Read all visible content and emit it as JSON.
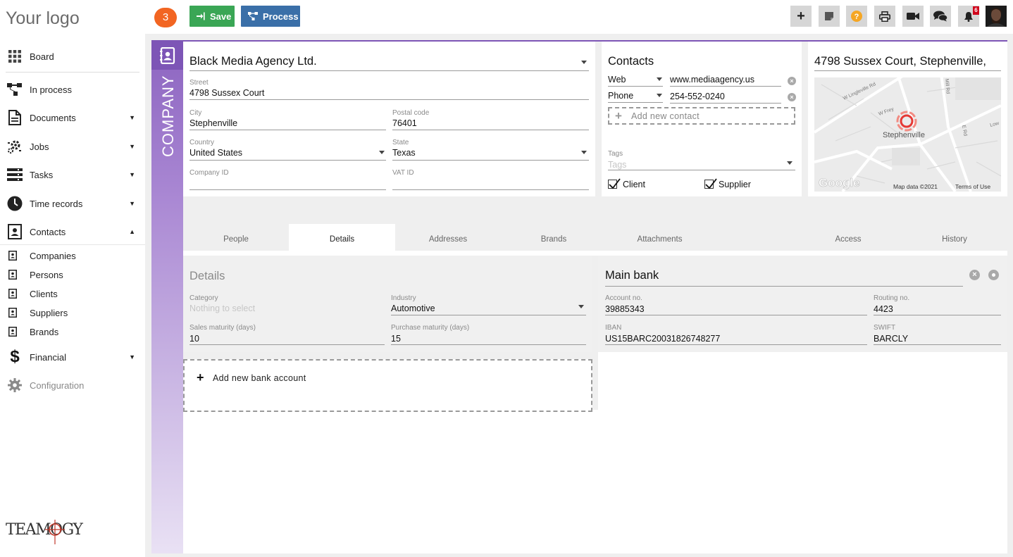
{
  "app": {
    "logo": "Your logo",
    "brand": "TEAMOGY",
    "step_badge": "3"
  },
  "toolbar": {
    "save_label": "Save",
    "process_label": "Process",
    "notification_count": "6"
  },
  "sidebar": {
    "items": [
      {
        "label": "Board",
        "icon": "grid-icon"
      },
      {
        "label": "In process",
        "icon": "process-icon"
      },
      {
        "label": "Documents",
        "icon": "document-icon"
      },
      {
        "label": "Jobs",
        "icon": "jobs-icon"
      },
      {
        "label": "Tasks",
        "icon": "tasks-icon"
      },
      {
        "label": "Time records",
        "icon": "clock-icon"
      },
      {
        "label": "Contacts",
        "icon": "contacts-icon"
      },
      {
        "label": "Financial",
        "icon": "dollar-icon"
      },
      {
        "label": "Configuration",
        "icon": "gear-icon"
      }
    ],
    "sub_items": [
      {
        "label": "Companies"
      },
      {
        "label": "Persons"
      },
      {
        "label": "Clients"
      },
      {
        "label": "Suppliers"
      },
      {
        "label": "Brands"
      }
    ]
  },
  "company": {
    "section_label": "COMPANY",
    "name": "Black Media Agency Ltd.",
    "street_label": "Street",
    "street": "4798  Sussex Court",
    "city_label": "City",
    "city": "Stephenville",
    "postal_label": "Postal code",
    "postal": "76401",
    "country_label": "Country",
    "country": "United States",
    "state_label": "State",
    "state": "Texas",
    "company_id_label": "Company ID",
    "company_id": "",
    "vat_label": "VAT ID",
    "vat": ""
  },
  "contacts": {
    "title": "Contacts",
    "rows": [
      {
        "type": "Web",
        "value": "www.mediaagency.us"
      },
      {
        "type": "Phone",
        "value": "254-552-0240"
      }
    ],
    "add_label": "Add new contact",
    "tags_label": "Tags",
    "tags_placeholder": "Tags",
    "client_label": "Client",
    "supplier_label": "Supplier"
  },
  "map": {
    "address": "4798 Sussex Court, Stephenville,",
    "city_label": "Stephenville",
    "roads": [
      "W Lingleville Rd",
      "W Frey",
      "Mill Rd",
      "E Rd",
      "Low"
    ],
    "google": "Google",
    "map_data": "Map data ©2021",
    "terms": "Terms of Use"
  },
  "tabs": [
    {
      "label": "People"
    },
    {
      "label": "Details"
    },
    {
      "label": "Addresses"
    },
    {
      "label": "Brands"
    },
    {
      "label": "Attachments"
    },
    {
      "label": "Access"
    },
    {
      "label": "History"
    }
  ],
  "details": {
    "title": "Details",
    "category_label": "Category",
    "category_placeholder": "Nothing to select",
    "industry_label": "Industry",
    "industry": "Automotive",
    "sales_label": "Sales maturity (days)",
    "sales": "10",
    "purchase_label": "Purchase maturity (days)",
    "purchase": "15"
  },
  "bank": {
    "title": "Main bank",
    "account_label": "Account no.",
    "account": "39885343",
    "routing_label": "Routing no.",
    "routing": "4423",
    "iban_label": "IBAN",
    "iban": "US15BARC20031826748277",
    "swift_label": "SWIFT",
    "swift": "BARCLY",
    "add_label": "Add new bank account"
  },
  "colors": {
    "accent_purple": "#7d55b6",
    "save_green": "#3aa655",
    "process_blue": "#3a6fa8",
    "badge_orange": "#f26522",
    "help_orange": "#f5a623",
    "notif_red": "#d0021b"
  }
}
